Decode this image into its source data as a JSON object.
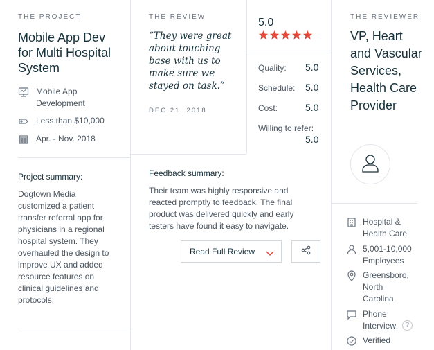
{
  "project": {
    "caption": "THE PROJECT",
    "title": "Mobile App Dev for Multi Hospital System",
    "meta": [
      {
        "icon": "monitor-icon",
        "text": "Mobile App Development"
      },
      {
        "icon": "price-tag-icon",
        "text": "Less than $10,000"
      },
      {
        "icon": "calendar-icon",
        "text": "Apr. - Nov. 2018"
      }
    ],
    "summary_label": "Project summary:",
    "summary": "Dogtown Media customized a patient transfer referral app for physicians in a regional hospital system. They overhauled the design to improve UX and added resource features on clinical guidelines and protocols."
  },
  "review": {
    "caption": "THE REVIEW",
    "quote": "“They were great about touching base with us to make sure we stayed on task.”",
    "date": "DEC 21, 2018",
    "overall": "5.0",
    "stars": 5,
    "star_color": "#e8473a",
    "ratings": [
      {
        "label": "Quality:",
        "value": "5.0"
      },
      {
        "label": "Schedule:",
        "value": "5.0"
      },
      {
        "label": "Cost:",
        "value": "5.0"
      },
      {
        "label": "Willing to refer:",
        "value": "5.0"
      }
    ],
    "feedback_label": "Feedback summary:",
    "feedback": "Their team was highly responsive and reacted promptly to feedback. The final product was delivered quickly and early testers have found it easy to navigate.",
    "read_full_label": "Read Full Review",
    "accent": "#e8473a"
  },
  "reviewer": {
    "caption": "THE REVIEWER",
    "title": "VP, Heart and Vascular Services, Health Care Provider",
    "meta": [
      {
        "icon": "building-icon",
        "text": "Hospital & Health Care"
      },
      {
        "icon": "person-icon",
        "text": "5,001-10,000 Employees"
      },
      {
        "icon": "location-pin-icon",
        "text": "Greensboro, North Carolina"
      },
      {
        "icon": "chat-bubble-icon",
        "text": "Phone Interview"
      },
      {
        "icon": "check-circle-icon",
        "text": "Verified"
      }
    ]
  }
}
